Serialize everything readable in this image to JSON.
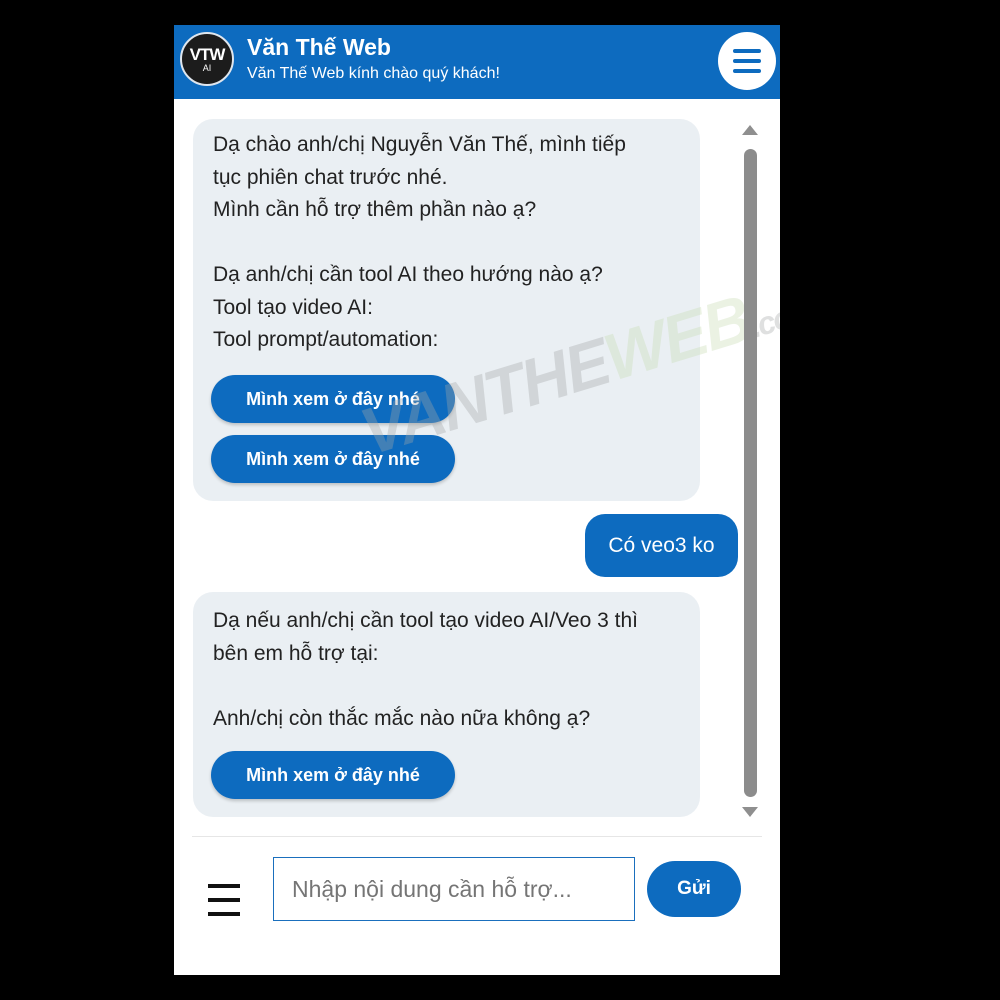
{
  "header": {
    "logo_text": "VTW",
    "logo_sub": "AI",
    "title": "Văn Thế Web",
    "subtitle": "Văn Thế Web kính chào quý khách!"
  },
  "watermark": {
    "part1": "VANTHE",
    "part2": "WEB",
    "part3": ".com"
  },
  "messages": [
    {
      "role": "bot",
      "text": "Dạ chào anh/chị Nguyễn Văn Thế, mình tiếp\ntục phiên chat trước nhé.\nMình cần hỗ trợ thêm phần nào ạ?\n\nDạ anh/chị cần tool AI theo hướng nào ạ?\nTool tạo video AI:\nTool prompt/automation:",
      "buttons": [
        "Mình xem ở đây nhé",
        "Mình xem ở đây nhé"
      ]
    },
    {
      "role": "user",
      "text": "Có veo3 ko"
    },
    {
      "role": "bot",
      "text": "Dạ nếu anh/chị cần tool tạo video AI/Veo 3 thì\nbên em hỗ trợ tại:\n\nAnh/chị còn thắc mắc nào nữa không ạ?",
      "buttons": [
        "Mình xem ở đây nhé"
      ]
    }
  ],
  "composer": {
    "placeholder": "Nhập nội dung cần hỗ trợ...",
    "value": "",
    "send_label": "Gửi"
  },
  "colors": {
    "brand": "#0d6bbf",
    "bot_bubble": "#eaeff3"
  },
  "icons": [
    "menu-icon",
    "scroll-up-arrow-icon",
    "scroll-down-arrow-icon",
    "composer-menu-icon"
  ]
}
